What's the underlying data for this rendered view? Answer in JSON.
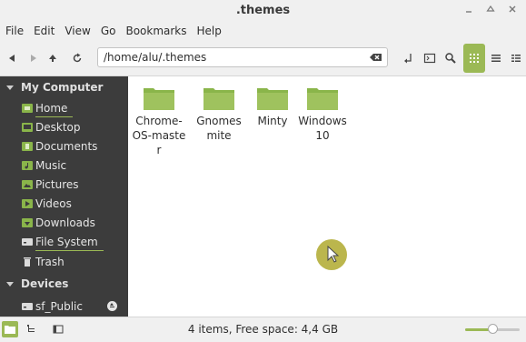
{
  "window": {
    "title": ".themes"
  },
  "menu": [
    "File",
    "Edit",
    "View",
    "Go",
    "Bookmarks",
    "Help"
  ],
  "toolbar": {
    "location": "/home/alu/.themes",
    "icons": [
      "back-icon",
      "forward-icon",
      "up-icon",
      "reload-icon",
      "clear-location-icon",
      "terminal-toggle-icon",
      "terminal-icon",
      "search-icon",
      "icon-view-icon",
      "list-view-icon",
      "compact-view-icon"
    ]
  },
  "sidebar": {
    "sections": [
      {
        "title": "My Computer",
        "items": [
          {
            "label": "Home",
            "icon": "home-folder-icon"
          },
          {
            "label": "Desktop",
            "icon": "desktop-icon"
          },
          {
            "label": "Documents",
            "icon": "documents-icon"
          },
          {
            "label": "Music",
            "icon": "music-icon"
          },
          {
            "label": "Pictures",
            "icon": "pictures-icon"
          },
          {
            "label": "Videos",
            "icon": "videos-icon"
          },
          {
            "label": "Downloads",
            "icon": "downloads-icon"
          },
          {
            "label": "File System",
            "icon": "drive-icon"
          },
          {
            "label": "Trash",
            "icon": "trash-icon"
          }
        ]
      },
      {
        "title": "Devices",
        "items": [
          {
            "label": "sf_Public",
            "icon": "drive-icon"
          }
        ]
      }
    ]
  },
  "files": [
    {
      "name": "Chrome-OS-master",
      "icon": "folder-icon"
    },
    {
      "name": "Gnomesmite",
      "icon": "folder-icon"
    },
    {
      "name": "Minty",
      "icon": "folder-icon"
    },
    {
      "name": "Windows 10",
      "icon": "folder-icon"
    }
  ],
  "status": {
    "text": "4 items, Free space: 4,4 GB",
    "zoom_level": 0.5
  },
  "colors": {
    "accent": "#9bb955",
    "folder": "#8ab54a",
    "sidebar_bg": "#3c3c3c",
    "cursor_highlight": "#b4af3a"
  }
}
